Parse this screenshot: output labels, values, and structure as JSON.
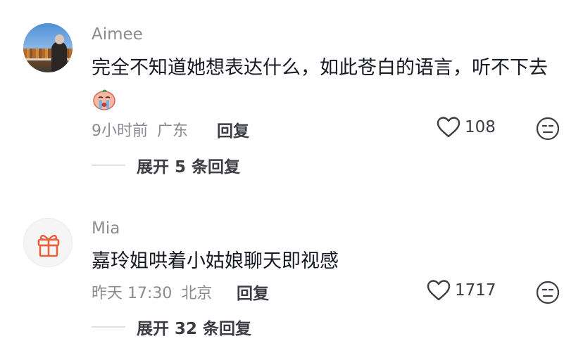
{
  "comments": [
    {
      "username": "Aimee",
      "text": "完全不知道她想表达什么，如此苍白的语言，听不下去",
      "time": "9小时前",
      "location": "广东",
      "reply_label": "回复",
      "like_count": "108",
      "expand_label": "展开 5 条回复",
      "avatar_icon": "avatar-photo",
      "emoji_icon": "crying-face-emoji"
    },
    {
      "username": "Mia",
      "text": "嘉玲姐哄着小姑娘聊天即视感",
      "time": "昨天 17:30",
      "location": "北京",
      "reply_label": "回复",
      "like_count": "1717",
      "expand_label": "展开 32 条回复",
      "avatar_icon": "gift-icon"
    }
  ],
  "colors": {
    "gift": "#e8603c",
    "muted": "#8a8b91",
    "text": "#161823"
  }
}
